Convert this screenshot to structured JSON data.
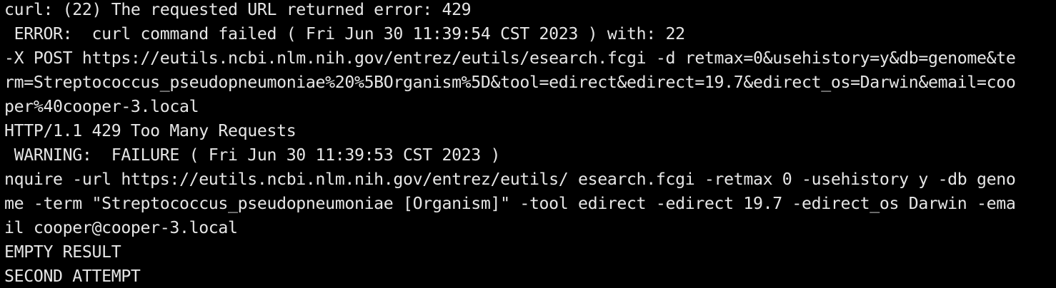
{
  "terminal": {
    "background": "#000000",
    "text_color": "#e6e6e6",
    "lines": [
      "curl: (22) The requested URL returned error: 429",
      " ERROR:  curl command failed ( Fri Jun 30 11:39:54 CST 2023 ) with: 22",
      "-X POST https://eutils.ncbi.nlm.nih.gov/entrez/eutils/esearch.fcgi -d retmax=0&usehistory=y&db=genome&te",
      "rm=Streptococcus_pseudopneumoniae%20%5BOrganism%5D&tool=edirect&edirect=19.7&edirect_os=Darwin&email=coo",
      "per%40cooper-3.local",
      "HTTP/1.1 429 Too Many Requests",
      " WARNING:  FAILURE ( Fri Jun 30 11:39:53 CST 2023 )",
      "nquire -url https://eutils.ncbi.nlm.nih.gov/entrez/eutils/ esearch.fcgi -retmax 0 -usehistory y -db geno",
      "me -term \"Streptococcus_pseudopneumoniae [Organism]\" -tool edirect -edirect 19.7 -edirect_os Darwin -ema",
      "il cooper@cooper-3.local",
      "EMPTY RESULT",
      "SECOND ATTEMPT"
    ]
  }
}
